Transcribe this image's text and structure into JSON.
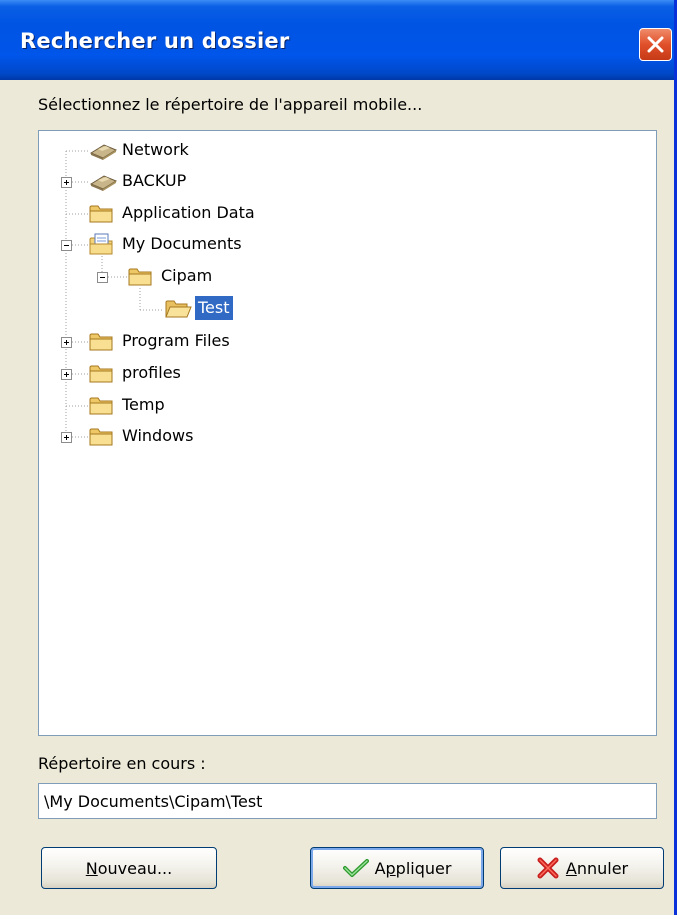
{
  "window": {
    "title": "Rechercher un dossier",
    "close_icon": "close-icon"
  },
  "prompt": "Sélectionnez le répertoire de l'appareil mobile...",
  "tree": {
    "items": [
      {
        "label": "Network",
        "icon": "network-drive-icon",
        "expander": "none",
        "depth": 0
      },
      {
        "label": "BACKUP",
        "icon": "network-drive-icon",
        "expander": "collapsed",
        "depth": 0
      },
      {
        "label": "Application Data",
        "icon": "folder-icon",
        "expander": "none",
        "depth": 0
      },
      {
        "label": "My Documents",
        "icon": "documents-folder-icon",
        "expander": "expanded",
        "depth": 0
      },
      {
        "label": "Cipam",
        "icon": "folder-icon",
        "expander": "expanded",
        "depth": 1
      },
      {
        "label": "Test",
        "icon": "open-folder-icon",
        "expander": "none",
        "depth": 2,
        "selected": true
      },
      {
        "label": "Program Files",
        "icon": "folder-icon",
        "expander": "collapsed",
        "depth": 0
      },
      {
        "label": "profiles",
        "icon": "folder-icon",
        "expander": "collapsed",
        "depth": 0
      },
      {
        "label": "Temp",
        "icon": "folder-icon",
        "expander": "none",
        "depth": 0
      },
      {
        "label": "Windows",
        "icon": "folder-icon",
        "expander": "collapsed",
        "depth": 0
      }
    ]
  },
  "current": {
    "label": "Répertoire en cours :",
    "value": "\\My Documents\\Cipam\\Test"
  },
  "buttons": {
    "new": {
      "mnemonic": "N",
      "rest": "ouveau..."
    },
    "apply": {
      "mnemonic": "p",
      "prefix": "A",
      "rest": "pliquer",
      "icon": "checkmark-icon"
    },
    "cancel": {
      "mnemonic": "A",
      "rest": "nnuler",
      "icon": "red-x-icon"
    }
  },
  "colors": {
    "titlebar": "#0054e3",
    "selection": "#316ac5",
    "dialog_bg": "#ece9d8"
  }
}
